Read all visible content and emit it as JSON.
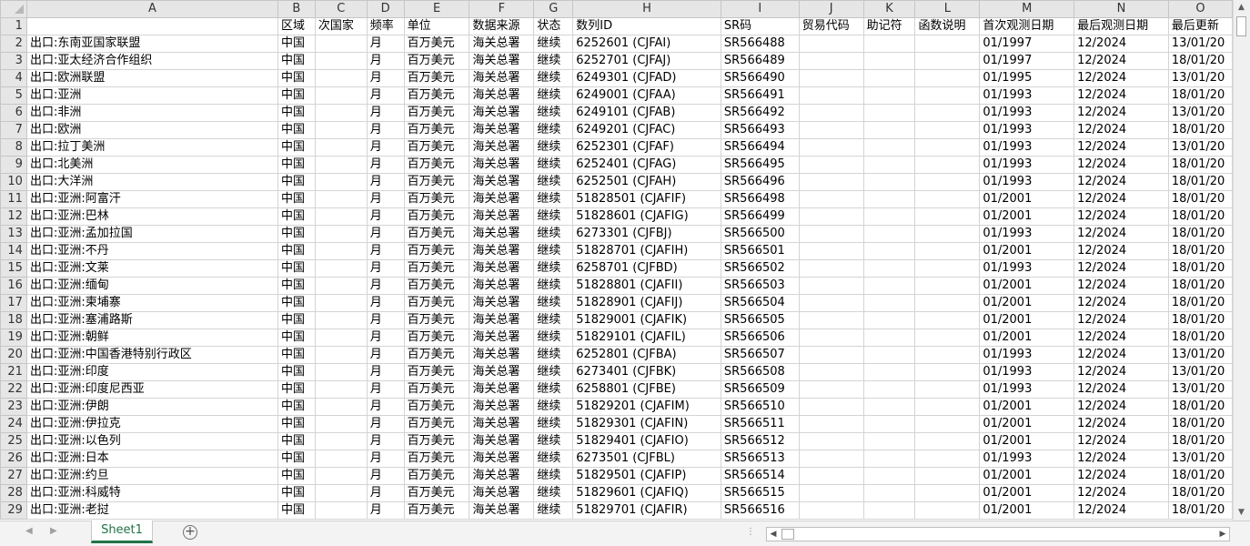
{
  "sheet": {
    "columns": [
      "A",
      "B",
      "C",
      "D",
      "E",
      "F",
      "G",
      "H",
      "I",
      "J",
      "K",
      "L",
      "M",
      "N",
      "O"
    ],
    "header_row": [
      "",
      "区域",
      "次国家",
      "频率",
      "单位",
      "数据来源",
      "状态",
      "数列ID",
      "SR码",
      "贸易代码",
      "助记符",
      "函数说明",
      "首次观测日期",
      "最后观测日期",
      "最后更新"
    ],
    "rows": [
      [
        "出口:东南亚国家联盟",
        "中国",
        "",
        "月",
        "百万美元",
        "海关总署",
        "继续",
        "6252601 (CJFAI)",
        "SR566488",
        "",
        "",
        "",
        "01/1997",
        "12/2024",
        "13/01/20"
      ],
      [
        "出口:亚太经济合作组织",
        "中国",
        "",
        "月",
        "百万美元",
        "海关总署",
        "继续",
        "6252701 (CJFAJ)",
        "SR566489",
        "",
        "",
        "",
        "01/1997",
        "12/2024",
        "18/01/20"
      ],
      [
        "出口:欧洲联盟",
        "中国",
        "",
        "月",
        "百万美元",
        "海关总署",
        "继续",
        "6249301 (CJFAD)",
        "SR566490",
        "",
        "",
        "",
        "01/1995",
        "12/2024",
        "13/01/20"
      ],
      [
        "出口:亚洲",
        "中国",
        "",
        "月",
        "百万美元",
        "海关总署",
        "继续",
        "6249001 (CJFAA)",
        "SR566491",
        "",
        "",
        "",
        "01/1993",
        "12/2024",
        "18/01/20"
      ],
      [
        "出口:非洲",
        "中国",
        "",
        "月",
        "百万美元",
        "海关总署",
        "继续",
        "6249101 (CJFAB)",
        "SR566492",
        "",
        "",
        "",
        "01/1993",
        "12/2024",
        "13/01/20"
      ],
      [
        "出口:欧洲",
        "中国",
        "",
        "月",
        "百万美元",
        "海关总署",
        "继续",
        "6249201 (CJFAC)",
        "SR566493",
        "",
        "",
        "",
        "01/1993",
        "12/2024",
        "18/01/20"
      ],
      [
        "出口:拉丁美洲",
        "中国",
        "",
        "月",
        "百万美元",
        "海关总署",
        "继续",
        "6252301 (CJFAF)",
        "SR566494",
        "",
        "",
        "",
        "01/1993",
        "12/2024",
        "13/01/20"
      ],
      [
        "出口:北美洲",
        "中国",
        "",
        "月",
        "百万美元",
        "海关总署",
        "继续",
        "6252401 (CJFAG)",
        "SR566495",
        "",
        "",
        "",
        "01/1993",
        "12/2024",
        "18/01/20"
      ],
      [
        "出口:大洋洲",
        "中国",
        "",
        "月",
        "百万美元",
        "海关总署",
        "继续",
        "6252501 (CJFAH)",
        "SR566496",
        "",
        "",
        "",
        "01/1993",
        "12/2024",
        "18/01/20"
      ],
      [
        "出口:亚洲:阿富汗",
        "中国",
        "",
        "月",
        "百万美元",
        "海关总署",
        "继续",
        "51828501 (CJAFIF)",
        "SR566498",
        "",
        "",
        "",
        "01/2001",
        "12/2024",
        "18/01/20"
      ],
      [
        "出口:亚洲:巴林",
        "中国",
        "",
        "月",
        "百万美元",
        "海关总署",
        "继续",
        "51828601 (CJAFIG)",
        "SR566499",
        "",
        "",
        "",
        "01/2001",
        "12/2024",
        "18/01/20"
      ],
      [
        "出口:亚洲:孟加拉国",
        "中国",
        "",
        "月",
        "百万美元",
        "海关总署",
        "继续",
        "6273301 (CJFBJ)",
        "SR566500",
        "",
        "",
        "",
        "01/1993",
        "12/2024",
        "18/01/20"
      ],
      [
        "出口:亚洲:不丹",
        "中国",
        "",
        "月",
        "百万美元",
        "海关总署",
        "继续",
        "51828701 (CJAFIH)",
        "SR566501",
        "",
        "",
        "",
        "01/2001",
        "12/2024",
        "18/01/20"
      ],
      [
        "出口:亚洲:文莱",
        "中国",
        "",
        "月",
        "百万美元",
        "海关总署",
        "继续",
        "6258701 (CJFBD)",
        "SR566502",
        "",
        "",
        "",
        "01/1993",
        "12/2024",
        "18/01/20"
      ],
      [
        "出口:亚洲:缅甸",
        "中国",
        "",
        "月",
        "百万美元",
        "海关总署",
        "继续",
        "51828801 (CJAFII)",
        "SR566503",
        "",
        "",
        "",
        "01/2001",
        "12/2024",
        "18/01/20"
      ],
      [
        "出口:亚洲:柬埔寨",
        "中国",
        "",
        "月",
        "百万美元",
        "海关总署",
        "继续",
        "51828901 (CJAFIJ)",
        "SR566504",
        "",
        "",
        "",
        "01/2001",
        "12/2024",
        "18/01/20"
      ],
      [
        "出口:亚洲:塞浦路斯",
        "中国",
        "",
        "月",
        "百万美元",
        "海关总署",
        "继续",
        "51829001 (CJAFIK)",
        "SR566505",
        "",
        "",
        "",
        "01/2001",
        "12/2024",
        "18/01/20"
      ],
      [
        "出口:亚洲:朝鲜",
        "中国",
        "",
        "月",
        "百万美元",
        "海关总署",
        "继续",
        "51829101 (CJAFIL)",
        "SR566506",
        "",
        "",
        "",
        "01/2001",
        "12/2024",
        "18/01/20"
      ],
      [
        "出口:亚洲:中国香港特别行政区",
        "中国",
        "",
        "月",
        "百万美元",
        "海关总署",
        "继续",
        "6252801 (CJFBA)",
        "SR566507",
        "",
        "",
        "",
        "01/1993",
        "12/2024",
        "13/01/20"
      ],
      [
        "出口:亚洲:印度",
        "中国",
        "",
        "月",
        "百万美元",
        "海关总署",
        "继续",
        "6273401 (CJFBK)",
        "SR566508",
        "",
        "",
        "",
        "01/1993",
        "12/2024",
        "13/01/20"
      ],
      [
        "出口:亚洲:印度尼西亚",
        "中国",
        "",
        "月",
        "百万美元",
        "海关总署",
        "继续",
        "6258801 (CJFBE)",
        "SR566509",
        "",
        "",
        "",
        "01/1993",
        "12/2024",
        "13/01/20"
      ],
      [
        "出口:亚洲:伊朗",
        "中国",
        "",
        "月",
        "百万美元",
        "海关总署",
        "继续",
        "51829201 (CJAFIM)",
        "SR566510",
        "",
        "",
        "",
        "01/2001",
        "12/2024",
        "18/01/20"
      ],
      [
        "出口:亚洲:伊拉克",
        "中国",
        "",
        "月",
        "百万美元",
        "海关总署",
        "继续",
        "51829301 (CJAFIN)",
        "SR566511",
        "",
        "",
        "",
        "01/2001",
        "12/2024",
        "18/01/20"
      ],
      [
        "出口:亚洲:以色列",
        "中国",
        "",
        "月",
        "百万美元",
        "海关总署",
        "继续",
        "51829401 (CJAFIO)",
        "SR566512",
        "",
        "",
        "",
        "01/2001",
        "12/2024",
        "18/01/20"
      ],
      [
        "出口:亚洲:日本",
        "中国",
        "",
        "月",
        "百万美元",
        "海关总署",
        "继续",
        "6273501 (CJFBL)",
        "SR566513",
        "",
        "",
        "",
        "01/1993",
        "12/2024",
        "13/01/20"
      ],
      [
        "出口:亚洲:约旦",
        "中国",
        "",
        "月",
        "百万美元",
        "海关总署",
        "继续",
        "51829501 (CJAFIP)",
        "SR566514",
        "",
        "",
        "",
        "01/2001",
        "12/2024",
        "18/01/20"
      ],
      [
        "出口:亚洲:科威特",
        "中国",
        "",
        "月",
        "百万美元",
        "海关总署",
        "继续",
        "51829601 (CJAFIQ)",
        "SR566515",
        "",
        "",
        "",
        "01/2001",
        "12/2024",
        "18/01/20"
      ],
      [
        "出口:亚洲:老挝",
        "中国",
        "",
        "月",
        "百万美元",
        "海关总署",
        "继续",
        "51829701 (CJAFIR)",
        "SR566516",
        "",
        "",
        "",
        "01/2001",
        "12/2024",
        "18/01/20"
      ]
    ]
  },
  "tabs": {
    "active_sheet": "Sheet1",
    "add_sheet_icon": "+",
    "nav_left_icon": "◀",
    "nav_right_icon": "▶"
  },
  "scrollbars": {
    "up_icon": "▲",
    "down_icon": "▼",
    "left_icon": "◀",
    "right_icon": "▶",
    "dots": "⋮"
  },
  "colors": {
    "accent": "#217346",
    "header_bg": "#e6e6e6",
    "gridline": "#d4d4d4"
  }
}
